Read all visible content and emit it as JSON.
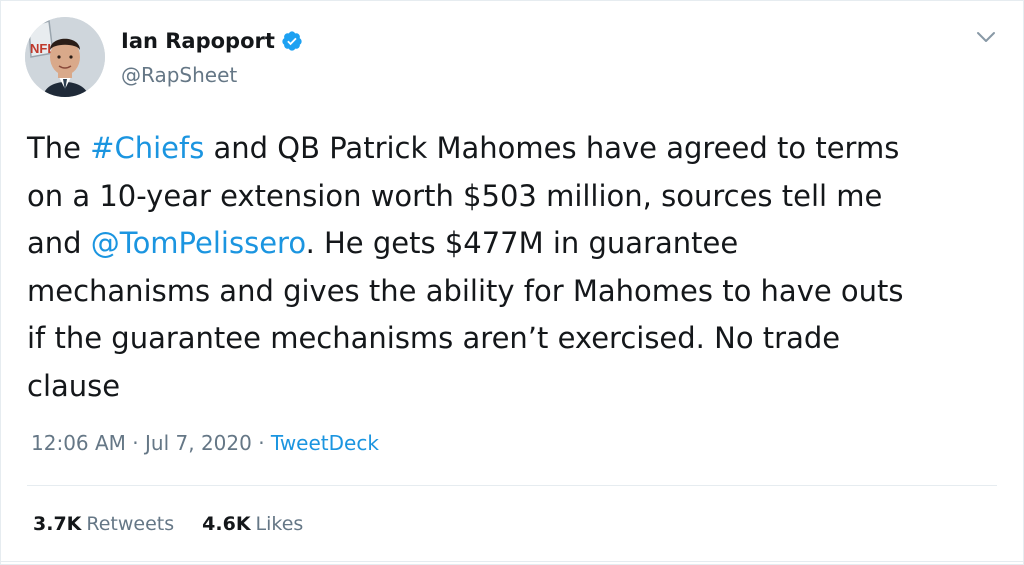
{
  "author": {
    "name": "Ian Rapoport",
    "handle": "@RapSheet",
    "verified": true,
    "avatar_icon": "profile-photo",
    "avatar_overlay_text": "NFL"
  },
  "tweet": {
    "lines": [
      [
        {
          "text": "The "
        },
        {
          "text": "#Chiefs",
          "link": true
        },
        {
          "text": " and QB Patrick Mahomes have agreed to terms"
        }
      ],
      [
        {
          "text": "on a 10-year extension worth $503 million, sources tell me"
        }
      ],
      [
        {
          "text": "and "
        },
        {
          "text": "@TomPelissero",
          "link": true
        },
        {
          "text": ". He gets $477M in guarantee"
        }
      ],
      [
        {
          "text": "mechanisms and gives the ability for Mahomes to have outs"
        }
      ],
      [
        {
          "text": "if the guarantee mechanisms aren’t exercised. No trade"
        }
      ],
      [
        {
          "text": "clause"
        }
      ]
    ]
  },
  "meta": {
    "time": "12:06 AM",
    "sep1": " · ",
    "date": "Jul 7, 2020",
    "sep2": " · ",
    "source": "TweetDeck"
  },
  "stats": {
    "retweets_count": "3.7K",
    "retweets_label": "Retweets",
    "likes_count": "4.6K",
    "likes_label": "Likes"
  },
  "colors": {
    "link": "#1b95e0",
    "verified": "#1da1f2",
    "text": "#14171a",
    "muted": "#657786"
  },
  "icons": {
    "verified": "verified-badge-icon",
    "more": "chevron-down-icon"
  }
}
